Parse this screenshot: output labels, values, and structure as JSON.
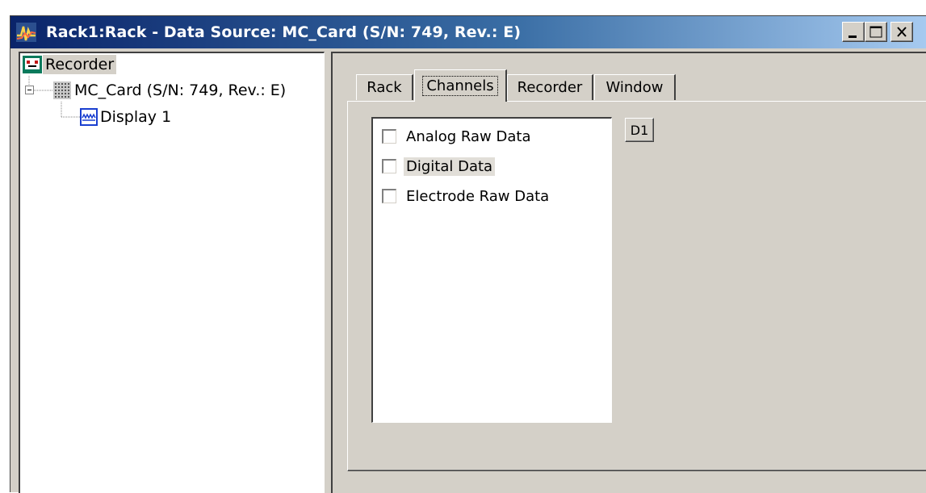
{
  "window": {
    "title": "Rack1:Rack - Data Source: MC_Card (S/N: 749, Rev.: E)",
    "controls": [
      "minimize",
      "maximize",
      "close"
    ]
  },
  "tree": {
    "items": [
      {
        "label": "Recorder",
        "icon": "recorder-icon",
        "selected": true
      },
      {
        "label": "MC_Card (S/N: 749, Rev.: E)",
        "icon": "card-icon",
        "expanded": true
      },
      {
        "label": "Display 1",
        "icon": "display-icon"
      }
    ]
  },
  "tabs": [
    {
      "label": "Rack"
    },
    {
      "label": "Channels",
      "active": true
    },
    {
      "label": "Recorder"
    },
    {
      "label": "Window"
    }
  ],
  "channels": {
    "items": [
      {
        "label": "Analog Raw Data",
        "checked": false
      },
      {
        "label": "Digital Data",
        "checked": false,
        "highlighted": true
      },
      {
        "label": "Electrode Raw Data",
        "checked": false
      }
    ],
    "display_button": "D1"
  }
}
